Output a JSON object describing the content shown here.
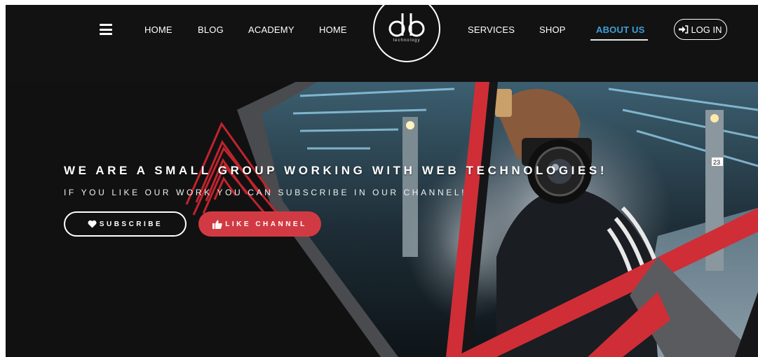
{
  "nav": {
    "left_links": [
      "HOME",
      "BLOG",
      "ACADEMY",
      "HOME"
    ],
    "right_links": [
      "SERVICES",
      "SHOP"
    ],
    "active_link": "ABOUT US",
    "login_label": "LOG IN"
  },
  "logo": {
    "tagline": "technology"
  },
  "hero": {
    "title": "WE ARE A SMALL GROUP WORKING WITH WEB TECHNOLOGIES!",
    "subtitle": "IF YOU LIKE OUR WORK YOU CAN SUBSCRIBE IN OUR CHANNEL!",
    "subscribe_label": "SUBSCRIBE",
    "like_label": "LIKE CHANNEL",
    "photo_caption": "23"
  },
  "colors": {
    "background": "#111112",
    "accent_red": "#d23a43",
    "active_blue": "#3f9fd6"
  },
  "icons": {
    "menu": "hamburger-icon",
    "login": "sign-in-icon",
    "subscribe": "heart-icon",
    "like": "thumbs-up-icon"
  }
}
